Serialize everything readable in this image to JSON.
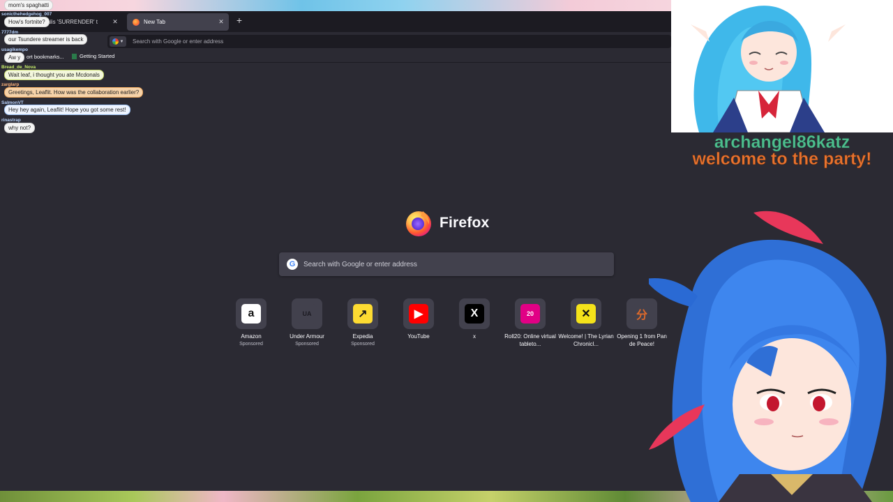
{
  "browser": {
    "tabs": [
      {
        "label": "00 Somalis 'SURRENDER' t",
        "active": false
      },
      {
        "label": "New Tab",
        "active": true
      }
    ],
    "new_tab_symbol": "+",
    "close_symbol": "✕",
    "urlbar_placeholder": "Search with Google or enter address",
    "bookmarks": {
      "import_label": "ort bookmarks...",
      "getting_started": "Getting Started"
    }
  },
  "newtab": {
    "brand": "Firefox",
    "search_placeholder": "Search with Google or enter address",
    "top_sites": [
      {
        "name": "Amazon",
        "sponsored": "Sponsored",
        "glyph": "a",
        "icon": "amazon-icon",
        "bg": "#ffffff",
        "fg": "#111111"
      },
      {
        "name": "Under Armour",
        "sponsored": "Sponsored",
        "glyph": "UA",
        "icon": "under-armour-icon",
        "bg": "#42414d",
        "fg": "#1c1b22"
      },
      {
        "name": "Expedia",
        "sponsored": "Sponsored",
        "glyph": "↗",
        "icon": "expedia-icon",
        "bg": "#fddb32",
        "fg": "#1a1a1a"
      },
      {
        "name": "YouTube",
        "sponsored": "",
        "glyph": "▶",
        "icon": "youtube-icon",
        "bg": "#ff0000",
        "fg": "#ffffff"
      },
      {
        "name": "x",
        "sponsored": "",
        "glyph": "X",
        "icon": "x-icon",
        "bg": "#000000",
        "fg": "#ffffff"
      },
      {
        "name": "Roll20: Online virtual tableto...",
        "sponsored": "",
        "glyph": "20",
        "icon": "roll20-icon",
        "bg": "#e10085",
        "fg": "#ffffff"
      },
      {
        "name": "Welcome! | The Lyrian Chronicl...",
        "sponsored": "",
        "glyph": "✕",
        "icon": "lyrian-icon",
        "bg": "#f4e21a",
        "fg": "#111111"
      },
      {
        "name": "Opening 1 from Pan de Peace!",
        "sponsored": "",
        "glyph": "分",
        "icon": "pan-de-peace-icon",
        "bg": "#42414d",
        "fg": "#e06a2a"
      }
    ]
  },
  "chat": [
    {
      "user": "",
      "message": "mom's spaghatti",
      "style": "plain"
    },
    {
      "user": "sonicthehedgehog_007",
      "message": "How's fortnite?",
      "style": "plain"
    },
    {
      "user": "7777dm",
      "message": "our Tsundere streamer is back",
      "style": "plain"
    },
    {
      "user": "usagikempo",
      "message": "Aw y",
      "style": "plain"
    },
    {
      "user": "Bread_de_Nova",
      "message": "Wait leaf, i thought you ate Mcdonals",
      "style": "green"
    },
    {
      "user": "zarglarp",
      "message": "Greetings, Leaflit. How was the collaboration earlier?",
      "style": "orange"
    },
    {
      "user": "SalmonVT",
      "message": "Hey hey again, Leaflit! Hope you got some rest!",
      "style": "blue"
    },
    {
      "user": "rinastrap",
      "message": "why not?",
      "style": "plain"
    }
  ],
  "alert": {
    "username": "archangel86katz",
    "message": "welcome to the party!"
  }
}
